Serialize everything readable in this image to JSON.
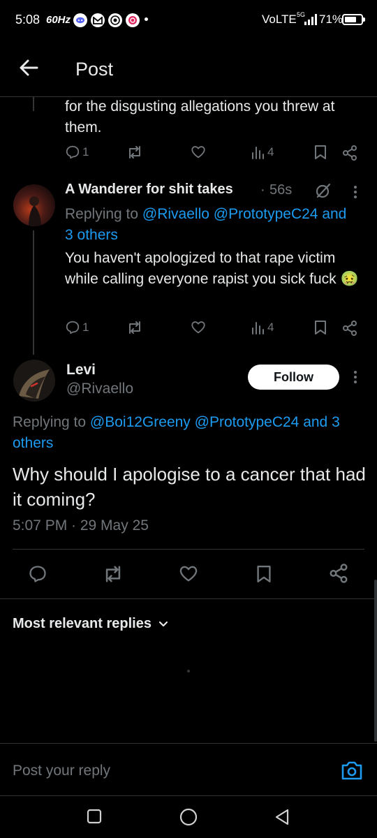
{
  "status_bar": {
    "time": "5:08",
    "refresh": "60Hz",
    "volte": "VoLTE",
    "network": "5G",
    "battery_percent": "71%",
    "battery_level": 0.71,
    "notification_icons": [
      "discord-icon",
      "gmail-icon",
      "chrome-icon",
      "app-notification-icon"
    ]
  },
  "header": {
    "title": "Post"
  },
  "tweet_above": {
    "text_partial": "for the disgusting allegations you threw at them.",
    "reply_count": "1",
    "views": "4"
  },
  "reply_tweet": {
    "author_name": "A Wanderer for shit takes",
    "separator": "·",
    "time_ago": "56s",
    "replying_prefix": "Replying to",
    "replying_to": "@Rivaello @PrototypeC24 and 3 others",
    "text": "You haven't apologized to that rape victim while calling everyone rapist you sick fuck 🤢",
    "reply_count": "1",
    "views": "4"
  },
  "main_post": {
    "author_name": "Levi",
    "handle": "@Rivaello",
    "follow_label": "Follow",
    "replying_prefix": "Replying to",
    "replying_to": "@Boi12Greeny @PrototypeC24 and 3 others",
    "text": "Why should I apologise to a cancer that had it coming?",
    "timestamp": "5:07 PM · 29 May 25"
  },
  "replies_section": {
    "sort_label": "Most relevant replies"
  },
  "reply_composer": {
    "placeholder": "Post your reply"
  },
  "colors": {
    "accent": "#1d9bf0",
    "muted": "#71767b",
    "text": "#e7e9ea",
    "background": "#000000",
    "border": "#2f3336"
  }
}
